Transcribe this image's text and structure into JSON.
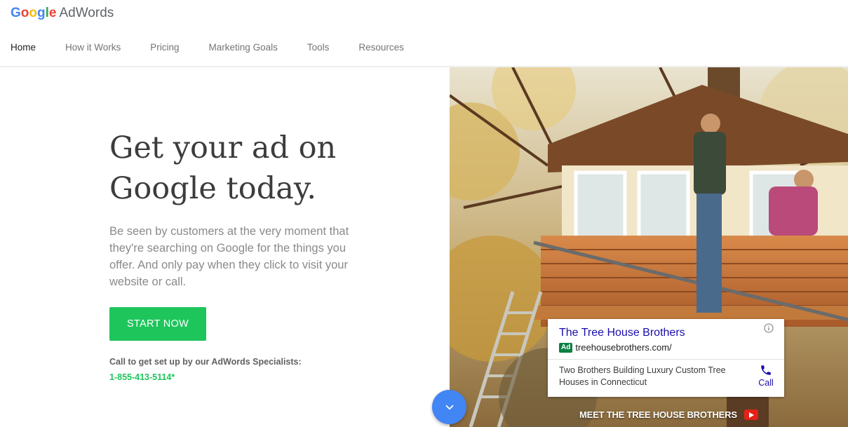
{
  "brand": {
    "logo_letters": [
      {
        "ch": "G",
        "color": "#4285F4"
      },
      {
        "ch": "o",
        "color": "#EA4335"
      },
      {
        "ch": "o",
        "color": "#FBBC05"
      },
      {
        "ch": "g",
        "color": "#4285F4"
      },
      {
        "ch": "l",
        "color": "#34A853"
      },
      {
        "ch": "e",
        "color": "#EA4335"
      }
    ],
    "product": "AdWords"
  },
  "nav": {
    "items": [
      {
        "label": "Home",
        "active": true
      },
      {
        "label": "How it Works"
      },
      {
        "label": "Pricing"
      },
      {
        "label": "Marketing Goals"
      },
      {
        "label": "Tools"
      },
      {
        "label": "Resources"
      }
    ]
  },
  "hero": {
    "title_line1": "Get your ad on",
    "title_line2": "Google today.",
    "body": "Be seen by customers at the very moment that they're searching on Google for the things you offer. And only pay when they click to visit your website or call.",
    "cta_label": "START NOW",
    "call_label": "Call to get set up by our AdWords Specialists:",
    "phone": "1-855-413-5114*"
  },
  "ad_card": {
    "title": "The Tree House Brothers",
    "badge": "Ad",
    "url": "treehousebrothers.com/",
    "description": "Two Brothers Building Luxury Custom Tree Houses in Connecticut",
    "call_label": "Call"
  },
  "video_link": {
    "label": "MEET THE TREE HOUSE BROTHERS"
  },
  "colors": {
    "accent_blue": "#4285f4",
    "cta_green": "#1ec55b",
    "ad_link": "#1a0dab",
    "ad_badge": "#0a8043",
    "youtube_red": "#e62117"
  },
  "icons": [
    "info-icon",
    "phone-icon",
    "chevron-down-icon",
    "youtube-play-icon"
  ]
}
